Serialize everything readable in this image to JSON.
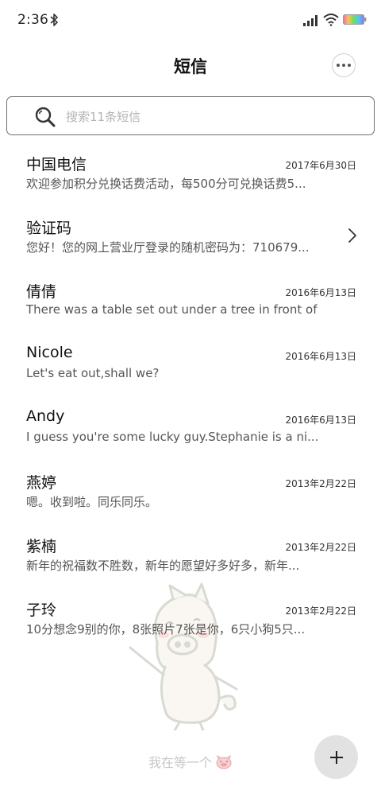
{
  "status_bar": {
    "time": "2:36",
    "icons": [
      "bluetooth-icon",
      "signal-icon",
      "wifi-icon",
      "battery-icon"
    ]
  },
  "header": {
    "title": "短信",
    "more_icon": "more-icon"
  },
  "search": {
    "placeholder": "搜索11条短信",
    "icon": "search-icon"
  },
  "messages": [
    {
      "sender": "中国电信",
      "date": "2017年6月30日",
      "preview": "欢迎参加积分兑换话费活动，每500分可兑换话费5..."
    },
    {
      "sender": "验证码",
      "date": "",
      "preview": "您好！您的网上营业厅登录的随机密码为：710679...",
      "icon": "chevron-right-icon"
    },
    {
      "sender": "倩倩",
      "date": "2016年6月13日",
      "preview": "There was a table set out under a tree in front of ..."
    },
    {
      "sender": "Nicole",
      "date": "2016年6月13日",
      "preview": "Let's eat out,shall we?"
    },
    {
      "sender": "Andy",
      "date": "2016年6月13日",
      "preview": "I guess you're some lucky guy.Stephanie is a ni..."
    },
    {
      "sender": "燕婷",
      "date": "2013年2月22日",
      "preview": "嗯。收到啦。同乐同乐。"
    },
    {
      "sender": "紫楠",
      "date": "2013年2月22日",
      "preview": "新年的祝福数不胜数，新年的愿望好多好多，新年..."
    },
    {
      "sender": "子玲",
      "date": "2013年2月22日",
      "preview": "10分想念9别的你，8张照片7张是你，6只小狗5只..."
    }
  ],
  "footer": {
    "note": "我在等一个",
    "note_icon": "pig-icon"
  },
  "fab": {
    "icon": "plus-icon"
  },
  "colors": {
    "background": "#ffffff",
    "text_primary": "#111111",
    "text_secondary": "#555555",
    "placeholder": "#b3b3b3",
    "fab_background": "#e2e2e2"
  }
}
